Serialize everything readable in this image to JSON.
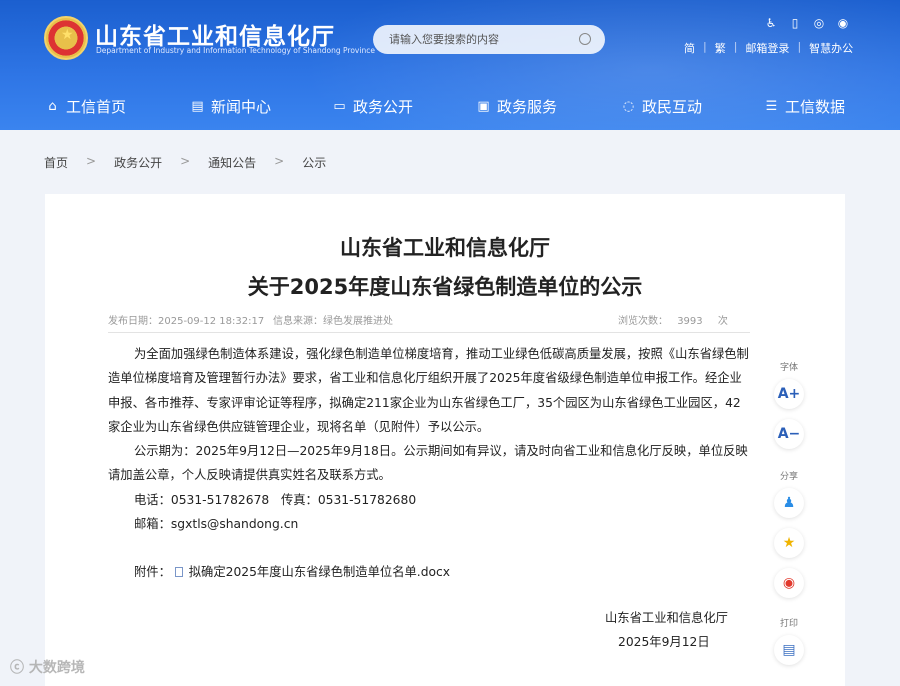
{
  "header": {
    "site_title": "山东省工业和信息化厅",
    "site_subtitle": "Department of Industry and Information Technology of Shandong Province",
    "search_placeholder": "请输入您要搜索的内容",
    "top_links": [
      "简",
      "繁",
      "邮箱登录",
      "智慧办公"
    ],
    "top_icons": [
      "accessibility-icon",
      "mobile-icon",
      "wechat-icon",
      "weibo-icon"
    ]
  },
  "nav": [
    "工信首页",
    "新闻中心",
    "政务公开",
    "政务服务",
    "政民互动",
    "工信数据"
  ],
  "breadcrumb": [
    "首页",
    "政务公开",
    "通知公告",
    "公示"
  ],
  "article": {
    "title_line1": "山东省工业和信息化厅",
    "title_line2": "关于2025年度山东省绿色制造单位的公示",
    "publish_label": "发布日期：",
    "publish_date": "2025-09-12 18:32:17",
    "source_label": "信息来源：",
    "source": "绿色发展推进处",
    "views_label": "浏览次数：",
    "views": "3993",
    "views_unit": "次",
    "para1": "为全面加强绿色制造体系建设，强化绿色制造单位梯度培育，推动工业绿色低碳高质量发展，按照《山东省绿色制造单位梯度培育及管理暂行办法》要求，省工业和信息化厅组织开展了2025年度省级绿色制造单位申报工作。经企业申报、各市推荐、专家评审论证等程序，拟确定211家企业为山东省绿色工厂，35个园区为山东省绿色工业园区，42家企业为山东省绿色供应链管理企业，现将名单（见附件）予以公示。",
    "para2": "公示期为：2025年9月12日—2025年9月18日。公示期间如有异议，请及时向省工业和信息化厅反映，单位反映请加盖公章，个人反映请提供真实姓名及联系方式。",
    "phone_line": "电话：0531-51782678   传真：0531-51782680",
    "email_line": "邮箱：sgxtls@shandong.cn",
    "attachment_label": "附件：",
    "attachment_name": "拟确定2025年度山东省绿色制造单位名单.docx",
    "signature_org": "山东省工业和信息化厅",
    "signature_date": "2025年9月12日"
  },
  "sidebar": {
    "font_label": "字体",
    "font_up": "A+",
    "font_down": "A−",
    "share_label": "分享",
    "print_label": "打印"
  },
  "watermark": "大数跨境"
}
